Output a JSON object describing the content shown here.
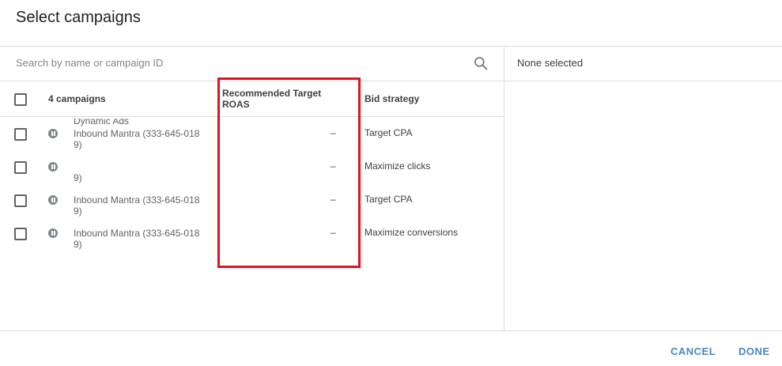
{
  "dialog": {
    "title": "Select campaigns"
  },
  "search": {
    "placeholder": "Search by name or campaign ID",
    "icon": "search-icon"
  },
  "selection_panel": {
    "status_text": "None selected"
  },
  "table": {
    "headers": {
      "campaigns": "4 campaigns",
      "recommended_target_roas": "Recommended Target ROAS",
      "bid_strategy": "Bid strategy"
    },
    "rows": [
      {
        "name_top_partial": "Dynamic Ads",
        "account_line1": "Inbound Mantra (333-645-018",
        "account_line2": "9)",
        "recommended_target_roas": "–",
        "bid_strategy": "Target CPA",
        "status_icon": "paused-icon"
      },
      {
        "name_top_partial": "",
        "account_line1": "",
        "account_line2": "9)",
        "recommended_target_roas": "–",
        "bid_strategy": "Maximize clicks",
        "status_icon": "paused-icon"
      },
      {
        "name_top_partial": "",
        "account_line1": "Inbound Mantra (333-645-018",
        "account_line2": "9)",
        "recommended_target_roas": "–",
        "bid_strategy": "Target CPA",
        "status_icon": "paused-icon"
      },
      {
        "name_top_partial": "Inbound Mantra (333-645-018",
        "account_line1": "",
        "account_line2": "9)",
        "recommended_target_roas": "–",
        "bid_strategy": "Maximize conversions",
        "status_icon": "paused-icon"
      }
    ]
  },
  "footer": {
    "cancel_label": "CANCEL",
    "done_label": "DONE"
  },
  "colors": {
    "accent": "#4a86c8",
    "highlight_border": "#e0141e",
    "divider": "#dadce0",
    "status_icon": "#80868b"
  }
}
